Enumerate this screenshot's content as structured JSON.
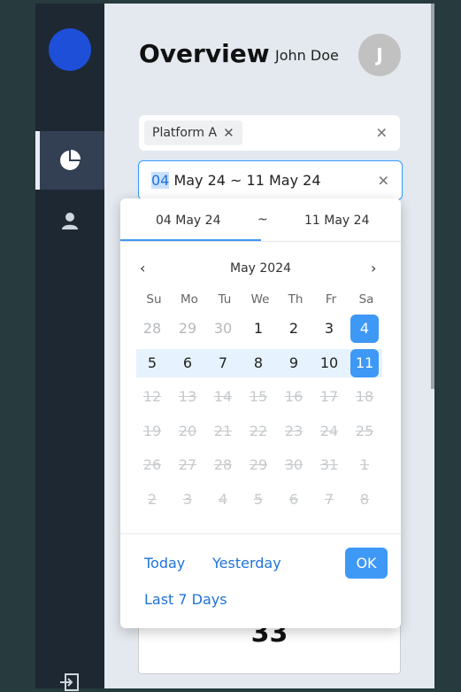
{
  "sidebar": {
    "items": [
      {
        "name": "overview",
        "icon": "pie-chart-icon",
        "active": true
      },
      {
        "name": "profile",
        "icon": "user-icon",
        "active": false
      }
    ],
    "logout_icon": "logout-icon"
  },
  "header": {
    "title": "Overview",
    "user_name": "John Doe",
    "avatar_initial": "J"
  },
  "filter": {
    "platform_chip": "Platform A",
    "chip_remove": "✕",
    "clear_icon": "✕"
  },
  "date_input": {
    "start_selected": "04",
    "rest": " May 24 ~ 11 May 24",
    "clear_icon": "✕"
  },
  "datepicker": {
    "start_tab": "04 May 24",
    "separator": "~",
    "end_tab": "11 May 24",
    "prev": "‹",
    "next": "›",
    "month_label": "May 2024",
    "weekdays": [
      "Su",
      "Mo",
      "Tu",
      "We",
      "Th",
      "Fr",
      "Sa"
    ],
    "weeks": [
      [
        "28",
        "29",
        "30",
        "1",
        "2",
        "3",
        "4"
      ],
      [
        "5",
        "6",
        "7",
        "8",
        "9",
        "10",
        "11"
      ],
      [
        "12",
        "13",
        "14",
        "15",
        "16",
        "17",
        "18"
      ],
      [
        "19",
        "20",
        "21",
        "22",
        "23",
        "24",
        "25"
      ],
      [
        "26",
        "27",
        "28",
        "29",
        "30",
        "31",
        "1"
      ],
      [
        "2",
        "3",
        "4",
        "5",
        "6",
        "7",
        "8"
      ]
    ],
    "quick_today": "Today",
    "quick_yesterday": "Yesterday",
    "quick_last7": "Last 7 Days",
    "ok": "OK"
  },
  "bottom_card": {
    "value": "33"
  },
  "colors": {
    "accent": "#3e98f5",
    "sidebar": "#1e2832",
    "range": "#e6f2fd"
  }
}
